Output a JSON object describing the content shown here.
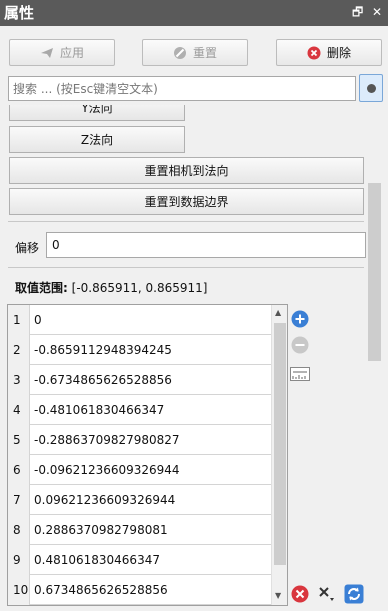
{
  "titlebar": {
    "title": "属性",
    "float_glyph": "🗗",
    "close_glyph": "✕"
  },
  "toolbar": {
    "apply_label": "应用",
    "reset_label": "重置",
    "delete_label": "删除"
  },
  "search": {
    "placeholder": "搜索 ... (按Esc键清空文本)",
    "value": ""
  },
  "panel": {
    "btn_y_normal": "Y法向",
    "btn_z_normal": "Z法向",
    "btn_reset_camera": "重置相机到法向",
    "btn_reset_bounds": "重置到数据边界",
    "offset_label": "偏移",
    "offset_value": "0",
    "range_label": "取值范围:",
    "range_value": "[-0.865911, 0.865911]"
  },
  "table": {
    "rows": [
      {
        "index": "1",
        "value": "0"
      },
      {
        "index": "2",
        "value": "-0.8659112948394245"
      },
      {
        "index": "3",
        "value": "-0.6734865626528856"
      },
      {
        "index": "4",
        "value": "-0.481061830466347"
      },
      {
        "index": "5",
        "value": "-0.28863709827980827"
      },
      {
        "index": "6",
        "value": "-0.09621236609326944"
      },
      {
        "index": "7",
        "value": "0.09621236609326944"
      },
      {
        "index": "8",
        "value": "0.2886370982798081"
      },
      {
        "index": "9",
        "value": "0.481061830466347"
      },
      {
        "index": "10",
        "value": "0.6734865626528856"
      }
    ]
  },
  "colors": {
    "titlebar_bg": "#5a5a5a",
    "add_blue": "#3a7fd5",
    "delete_red": "#d9363e"
  }
}
